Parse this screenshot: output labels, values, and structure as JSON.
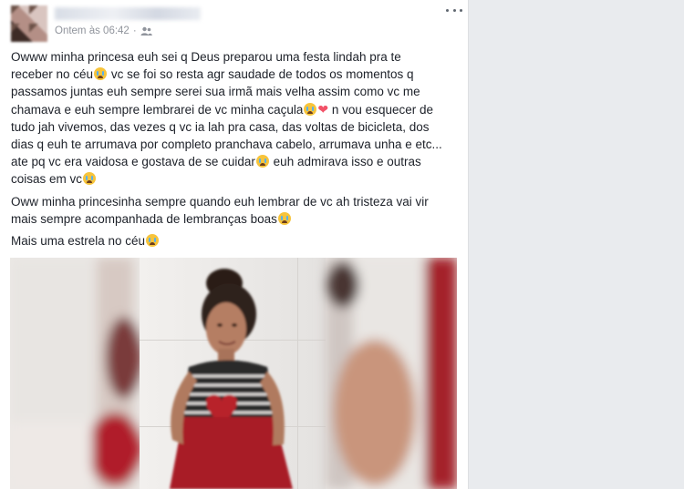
{
  "post": {
    "timestamp": "Ontem às 06:42",
    "separator": "·",
    "audience_icon": "friends-icon",
    "menu_icon": "more-options-icon",
    "paragraphs": [
      {
        "lines": [
          "Owww minha princesa euh sei q Deus preparou uma festa lindah pra te",
          [
            "receber no céu",
            "emoji",
            " vc se foi so resta agr saudade de todos os momentos q"
          ],
          "passamos juntas euh sempre serei sua irmã mais velha assim como vc me",
          [
            "chamava e euh sempre lembrarei de vc minha caçula",
            "emoji",
            "heart",
            " n vou esquecer de"
          ],
          "tudo jah vivemos, das vezes q vc ia lah pra casa, das voltas de bicicleta, dos",
          "dias q euh te arrumava por completo pranchava cabelo, arrumava unha e etc...",
          [
            "ate pq vc era vaidosa e gostava de se cuidar",
            "emoji",
            " euh admirava isso e outras"
          ],
          [
            "coisas em vc",
            "emoji"
          ]
        ]
      },
      {
        "lines": [
          "Oww minha princesinha sempre quando euh lembrar de vc ah tristeza vai vir",
          [
            "mais sempre acompanhada de lembranças boas",
            "emoji"
          ]
        ]
      },
      {
        "lines": [
          [
            "Mais uma estrela no céu",
            "emoji"
          ]
        ]
      }
    ],
    "emoji_name": "crying-face-emoji",
    "heart_glyph": "❤"
  },
  "colors": {
    "text": "#1d2129",
    "meta": "#90949c",
    "page_bg": "#e9ebee"
  }
}
